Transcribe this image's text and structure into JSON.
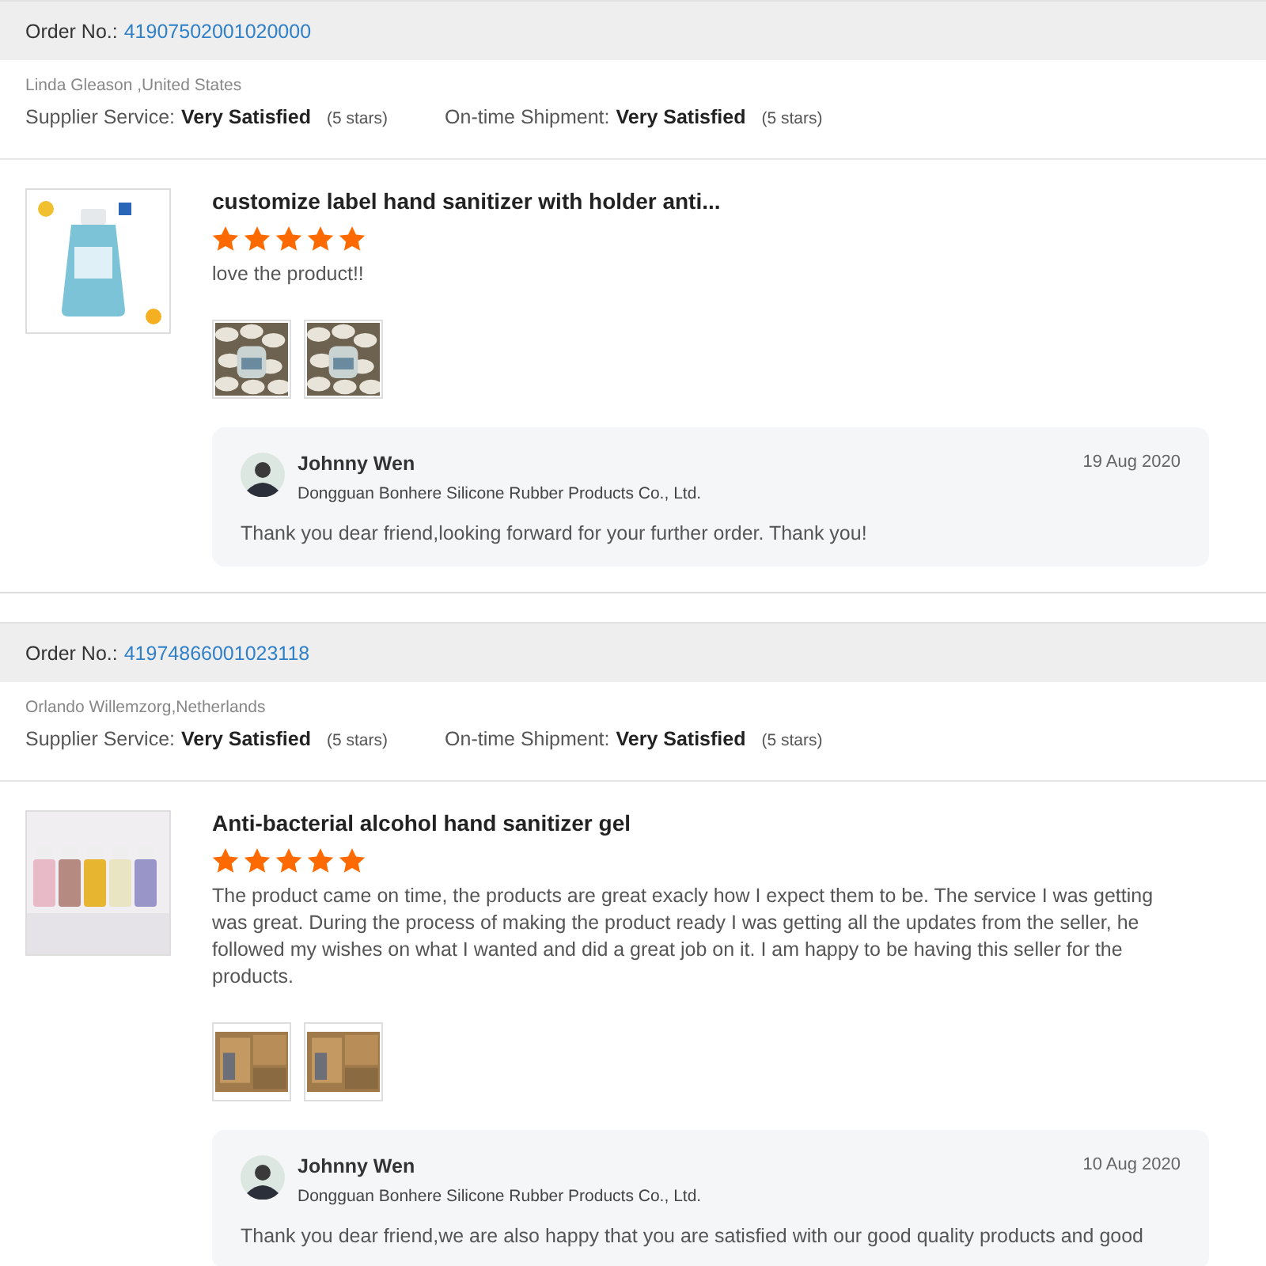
{
  "orders": [
    {
      "order_label": "Order No.:",
      "order_number": "41907502001020000",
      "buyer": "Linda Gleason ,United States",
      "ratings": [
        {
          "label": "Supplier Service:",
          "value": "Very Satisfied",
          "note": "(5 stars)"
        },
        {
          "label": "On-time Shipment:",
          "value": "Very Satisfied",
          "note": "(5 stars)"
        }
      ],
      "product": {
        "kind": "bottle",
        "title": "customize label hand sanitizer with holder anti...",
        "stars": 5,
        "comment": "love the product!!",
        "photos": [
          {
            "kind": "pebbles"
          },
          {
            "kind": "pebbles"
          }
        ]
      },
      "reply": {
        "name": "Johnny Wen",
        "company": "Dongguan Bonhere Silicone Rubber Products Co., Ltd.",
        "date": "19 Aug 2020",
        "text": "Thank you dear friend,looking forward for your further order. Thank you!"
      }
    },
    {
      "order_label": "Order No.:",
      "order_number": "41974866001023118",
      "buyer": "Orlando Willemzorg,Netherlands",
      "ratings": [
        {
          "label": "Supplier Service:",
          "value": "Very Satisfied",
          "note": "(5 stars)"
        },
        {
          "label": "On-time Shipment:",
          "value": "Very Satisfied",
          "note": "(5 stars)"
        }
      ],
      "product": {
        "kind": "bottles",
        "title": "Anti-bacterial alcohol hand sanitizer gel",
        "stars": 5,
        "comment": "The product came on time, the products are great exacly how I expect them to be. The service I was getting was great. During the process of making the product ready I was getting all the updates from the seller, he followed my wishes on what I wanted and did a great job on it. I am happy to be having this seller for the products.",
        "photos": [
          {
            "kind": "boxes"
          },
          {
            "kind": "boxes"
          }
        ]
      },
      "reply": {
        "name": "Johnny Wen",
        "company": "Dongguan Bonhere Silicone Rubber Products Co., Ltd.",
        "date": "10 Aug 2020",
        "text": "Thank you dear friend,we are also happy that you are satisfied with our good quality products and good"
      }
    }
  ]
}
